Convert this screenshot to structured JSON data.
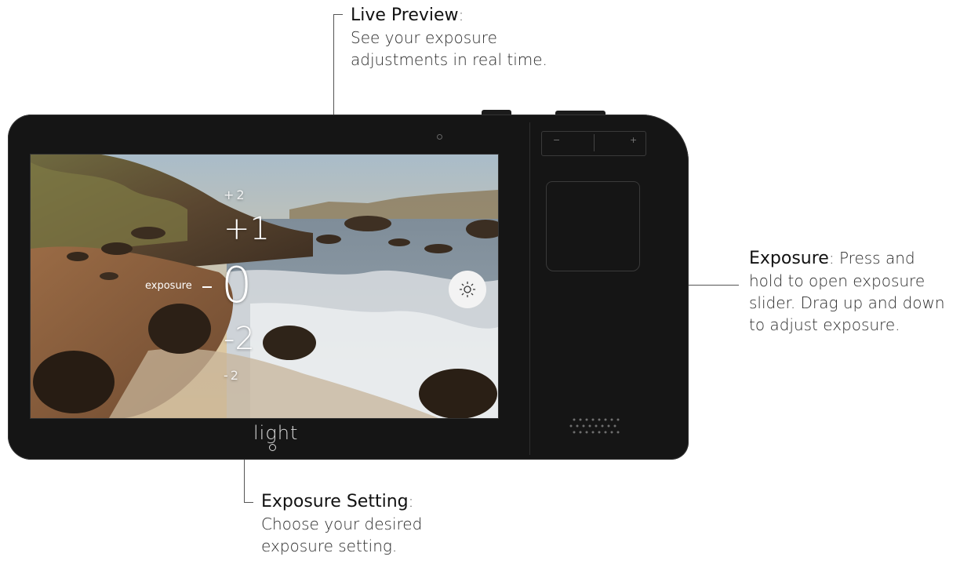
{
  "callouts": {
    "live_preview": {
      "title": "Live Preview",
      "title_suffix": ":",
      "body": [
        "See your exposure",
        "adjustments in real time."
      ]
    },
    "exposure": {
      "title": "Exposure",
      "title_suffix": ":",
      "body_first": "Press and",
      "body": [
        "hold to open exposure",
        "slider. Drag up and down",
        "to adjust exposure."
      ]
    },
    "exposure_setting": {
      "title": "Exposure Setting",
      "title_suffix": ":",
      "body": [
        "Choose your desired",
        "exposure setting."
      ]
    }
  },
  "screen": {
    "exposure_label": "exposure",
    "ev_scale": {
      "top_small": "+2",
      "upper": "+1",
      "current": "0",
      "lower": "-2",
      "bottom_small": "-2"
    },
    "exposure_button_icon": "sun-icon"
  },
  "device": {
    "logo": "light",
    "zoom_minus": "−",
    "zoom_plus": "+"
  }
}
